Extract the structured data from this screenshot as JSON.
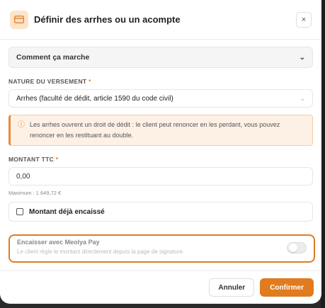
{
  "dialog": {
    "title": "Définir des arrhes ou un acompte",
    "close_label": "×",
    "accent": "#e07b20"
  },
  "accordion": {
    "label": "Comment ça marche",
    "icon": "chevron-down-icon"
  },
  "nature": {
    "label": "NATURE DU VERSEMENT",
    "required_mark": "*",
    "selected": "Arrhes (faculté de dédit, article 1590 du code civil)"
  },
  "alert": {
    "icon": "info-icon",
    "text": "Les arrhes ouvrent un droit de dédit : le client peut renoncer en les perdant, vous pouvez renoncer en les restituant au double."
  },
  "amount": {
    "label": "MONTANT TTC",
    "required_mark": "*",
    "value": "0,00",
    "hint": "Maximum : 1 649,72 €"
  },
  "collected": {
    "label": "Montant déjà encaissé",
    "checked": false
  },
  "meolya_pay": {
    "title": "Encaisser avec Meolya Pay",
    "subtitle": "Le client règle le montant directement depuis la page de signature.",
    "enabled": false
  },
  "footer": {
    "cancel_label": "Annuler",
    "confirm_label": "Confirmer"
  }
}
